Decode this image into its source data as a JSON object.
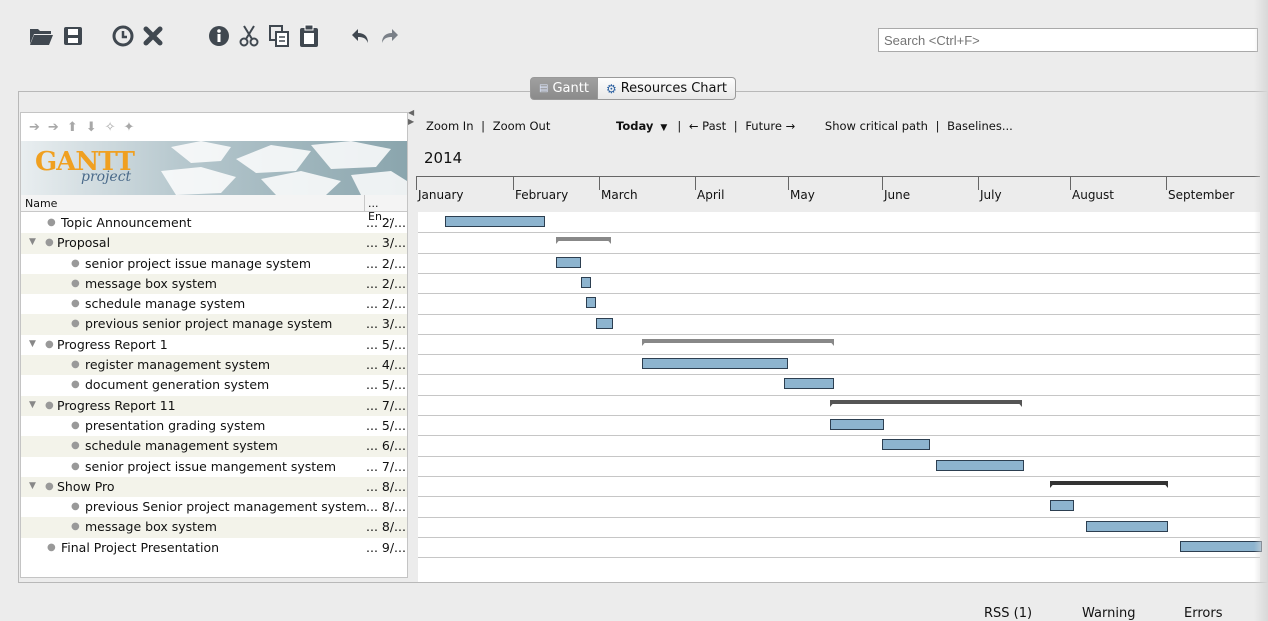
{
  "search": {
    "placeholder": "Search <Ctrl+F>"
  },
  "tabs": [
    {
      "label": "Gantt",
      "active": true
    },
    {
      "label": "Resources Chart",
      "active": false
    }
  ],
  "logo": {
    "text": "GANTT",
    "sub": "project"
  },
  "tree": {
    "col_name": "Name",
    "col_end": "... En...",
    "rows": [
      {
        "name": "Topic Announcement",
        "end": "... 2/...",
        "level": 0,
        "group": false
      },
      {
        "name": "Proposal",
        "end": "... 3/...",
        "level": 0,
        "group": true
      },
      {
        "name": "senior project issue manage system",
        "end": "... 2/...",
        "level": 1,
        "group": false
      },
      {
        "name": "message box system",
        "end": "... 2/...",
        "level": 1,
        "group": false
      },
      {
        "name": "schedule manage system",
        "end": "... 2/...",
        "level": 1,
        "group": false
      },
      {
        "name": "previous senior project manage system",
        "end": "... 3/...",
        "level": 1,
        "group": false
      },
      {
        "name": "Progress Report 1",
        "end": "... 5/...",
        "level": 0,
        "group": true
      },
      {
        "name": "register management system",
        "end": "... 4/...",
        "level": 1,
        "group": false
      },
      {
        "name": "document generation system",
        "end": "... 5/...",
        "level": 1,
        "group": false
      },
      {
        "name": "Progress Report 11",
        "end": "... 7/...",
        "level": 0,
        "group": true
      },
      {
        "name": "presentation grading system",
        "end": "... 5/...",
        "level": 1,
        "group": false
      },
      {
        "name": "schedule management system",
        "end": "... 6/...",
        "level": 1,
        "group": false
      },
      {
        "name": "senior project issue mangement system",
        "end": "... 7/...",
        "level": 1,
        "group": false
      },
      {
        "name": "Show Pro",
        "end": "... 8/...",
        "level": 0,
        "group": true
      },
      {
        "name": "previous Senior project management system",
        "end": "... 8/...",
        "level": 1,
        "group": false
      },
      {
        "name": "message box system",
        "end": "... 8/...",
        "level": 1,
        "group": false
      },
      {
        "name": "Final Project Presentation",
        "end": "... 9/...",
        "level": 0,
        "group": false
      }
    ]
  },
  "gantt_toolbar": {
    "zoom_in": "Zoom In",
    "zoom_out": "Zoom Out",
    "today": "Today",
    "past": "← Past",
    "future": "Future →",
    "critical": "Show critical path",
    "baselines": "Baselines..."
  },
  "timeline": {
    "year": "2014",
    "months": [
      "January",
      "February",
      "March",
      "April",
      "May",
      "June",
      "July",
      "August",
      "September"
    ]
  },
  "footer": {
    "rss": "RSS (1)",
    "warning": "Warning",
    "errors": "Errors"
  },
  "colors": {
    "task_bar": "#8db4cf",
    "summary_bar": "#888888"
  }
}
